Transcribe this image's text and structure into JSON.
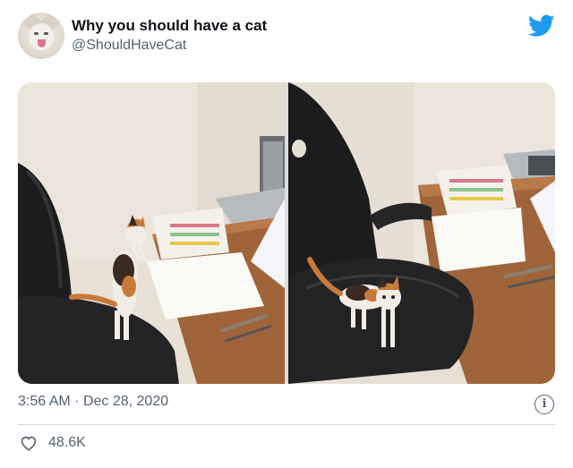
{
  "tweet": {
    "display_name": "Why you should have a cat",
    "handle": "@ShouldHaveCat",
    "time": "3:56 AM",
    "separator": "·",
    "date": "Dec 28, 2020",
    "like_count": "48.6K",
    "info_symbol": "i"
  },
  "media": {
    "photos": [
      {
        "description_name": "kitten-reaching-desk-photo"
      },
      {
        "description_name": "kitten-on-chair-photo"
      }
    ]
  },
  "icons": {
    "brand": "twitter-bird-icon",
    "like": "heart-icon",
    "info": "info-icon"
  },
  "colors": {
    "brand_blue": "#1d9bf0",
    "secondary_text": "#536471",
    "primary_text": "#0f1419",
    "divider": "#cfd9de"
  }
}
